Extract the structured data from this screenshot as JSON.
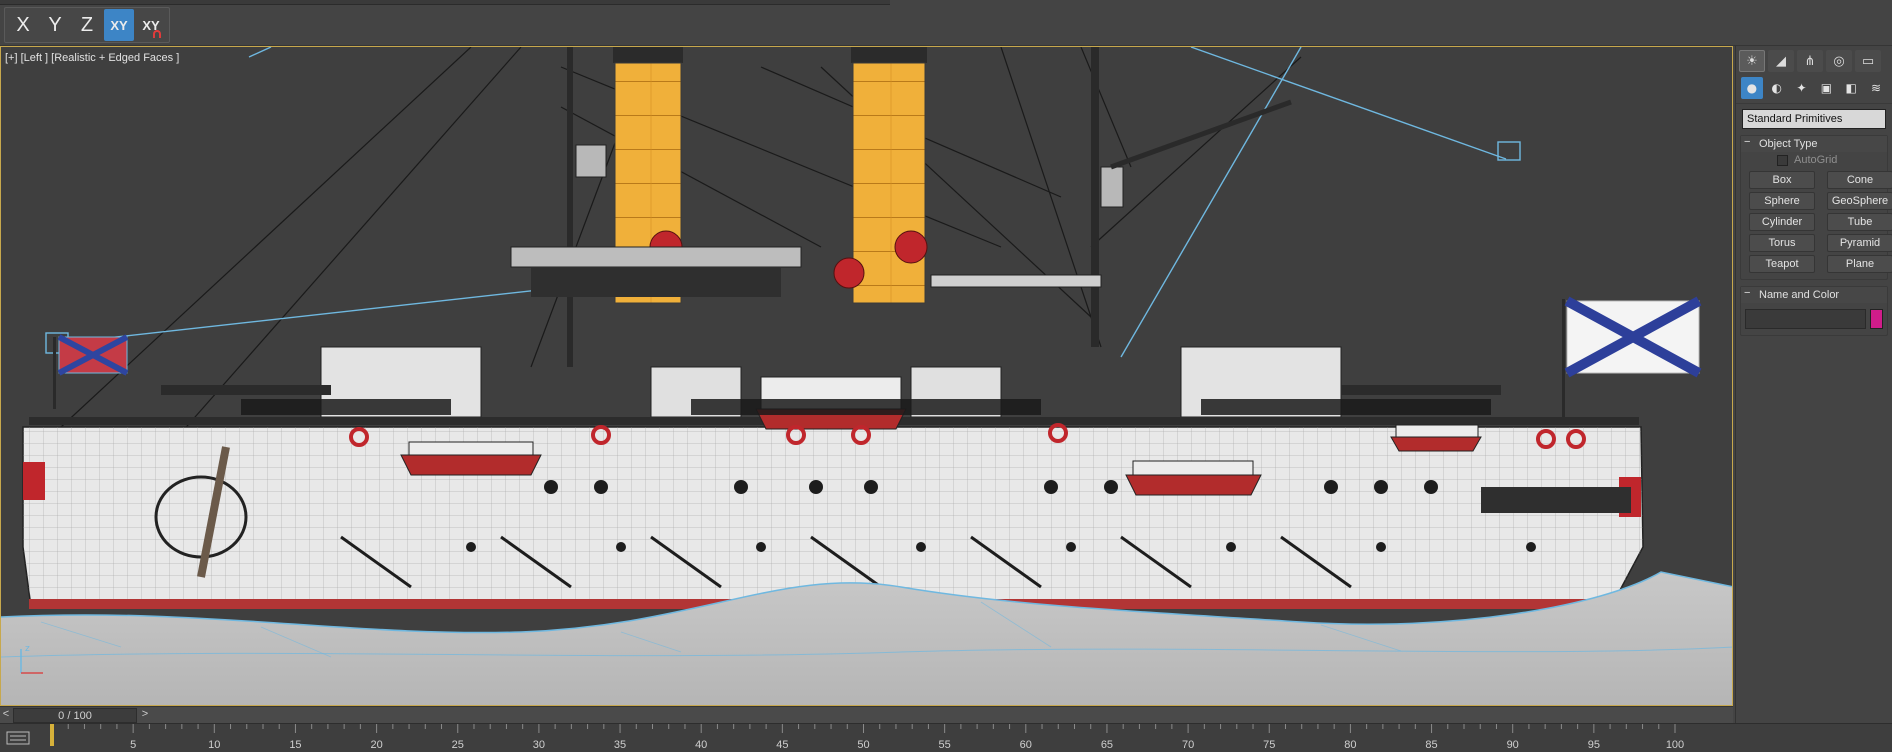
{
  "toolbar": {
    "axes": [
      {
        "label": "X",
        "active": false
      },
      {
        "label": "Y",
        "active": false
      },
      {
        "label": "Z",
        "active": false
      },
      {
        "label": "XY",
        "active": true
      },
      {
        "label": "XY",
        "active": false,
        "magnet": true
      }
    ]
  },
  "viewport": {
    "label": "[+] [Left ] [Realistic + Edged Faces ]"
  },
  "command_panel": {
    "category": "Standard Primitives",
    "object_type": {
      "title": "Object Type",
      "autogrid_label": "AutoGrid",
      "buttons": [
        "Box",
        "Cone",
        "Sphere",
        "GeoSphere",
        "Cylinder",
        "Tube",
        "Torus",
        "Pyramid",
        "Teapot",
        "Plane"
      ]
    },
    "name_and_color": {
      "title": "Name and Color",
      "name_value": "",
      "color": "#d11c8a"
    },
    "tab_icons": [
      "sun-icon",
      "curve-icon",
      "hierarchy-icon",
      "motion-icon",
      "display-icon",
      "utilities-icon"
    ],
    "sub_icons": [
      "geometry-icon",
      "shapes-icon",
      "lights-icon",
      "cameras-icon",
      "helpers-icon",
      "spacewarps-icon"
    ]
  },
  "timeline": {
    "frame_label": "0 / 100",
    "prev_label": "<",
    "next_label": ">",
    "ticks": [
      "5",
      "10",
      "15",
      "20",
      "25",
      "30",
      "35",
      "40",
      "45",
      "50",
      "55",
      "60",
      "65",
      "70",
      "75",
      "80",
      "85",
      "90",
      "95",
      "100"
    ]
  },
  "colors": {
    "accent": "#3d85c6",
    "viewport_border": "#c7a84d",
    "funnel": "#f0b03a",
    "hull": "#e8e8e8",
    "waterline": "#b23535",
    "wire": "#6fb8e0"
  }
}
